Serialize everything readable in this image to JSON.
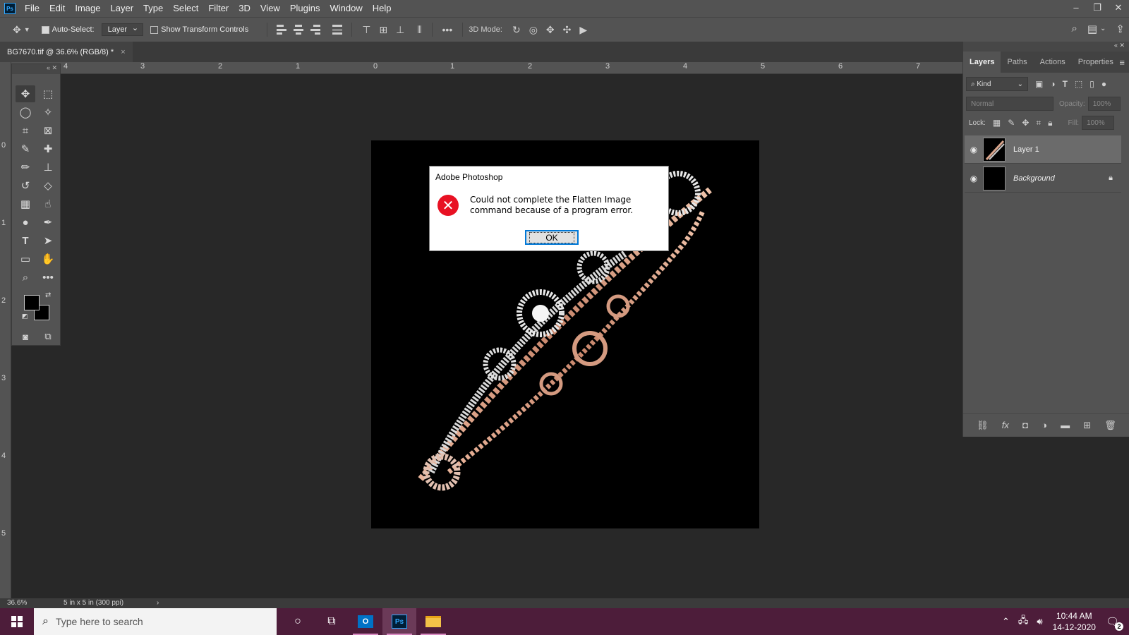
{
  "app": {
    "logo_text": "Ps",
    "menu": [
      "File",
      "Edit",
      "Image",
      "Layer",
      "Type",
      "Select",
      "Filter",
      "3D",
      "View",
      "Plugins",
      "Window",
      "Help"
    ],
    "window_controls": [
      "–",
      "❐",
      "✕"
    ]
  },
  "options_bar": {
    "auto_select_label": "Auto-Select:",
    "auto_select_checked": true,
    "auto_select_target": "Layer",
    "show_transform_label": "Show Transform Controls",
    "three_d_mode_label": "3D Mode:",
    "more_label": "•••"
  },
  "document": {
    "tab_title": "BG7670.tif @ 36.6% (RGB/8) *",
    "tab_close": "×",
    "ruler_top_labels": [
      "4",
      "3",
      "2",
      "1",
      "0",
      "1",
      "2",
      "3",
      "4",
      "5",
      "6",
      "7"
    ],
    "ruler_left_labels": [
      "0",
      "1",
      "2",
      "3",
      "4",
      "5"
    ]
  },
  "dialog": {
    "title": "Adobe Photoshop",
    "message": "Could not complete the Flatten Image command because of a program error.",
    "ok_label": "OK",
    "icon": "error-icon",
    "accent": "#e81123"
  },
  "layers_panel": {
    "tabs": [
      "Layers",
      "Paths",
      "Actions",
      "Properties"
    ],
    "active_tab": "Layers",
    "filter_kind": "Kind",
    "blend_mode": "Normal",
    "opacity_label": "Opacity:",
    "opacity_value": "100%",
    "lock_label": "Lock:",
    "fill_label": "Fill:",
    "fill_value": "100%",
    "layers": [
      {
        "name": "Layer 1",
        "visible": true,
        "selected": true,
        "locked": false
      },
      {
        "name": "Background",
        "visible": true,
        "selected": false,
        "locked": true
      }
    ]
  },
  "status_bar": {
    "zoom": "36.6%",
    "doc_info": "5 in x 5 in (300 ppi)",
    "arrow": "›"
  },
  "taskbar": {
    "search_placeholder": "Type here to search",
    "apps": [
      "cortana",
      "task-view",
      "outlook",
      "photoshop",
      "file-explorer"
    ],
    "outlook_label": "O",
    "photoshop_label": "Ps",
    "time": "10:44 AM",
    "date": "14-12-2020",
    "notification_count": "2"
  },
  "colors": {
    "ui_bg": "#535353",
    "canvas_bg": "#282828",
    "taskbar_bg": "#4d1d3a",
    "selection_blue": "#0078d7"
  }
}
